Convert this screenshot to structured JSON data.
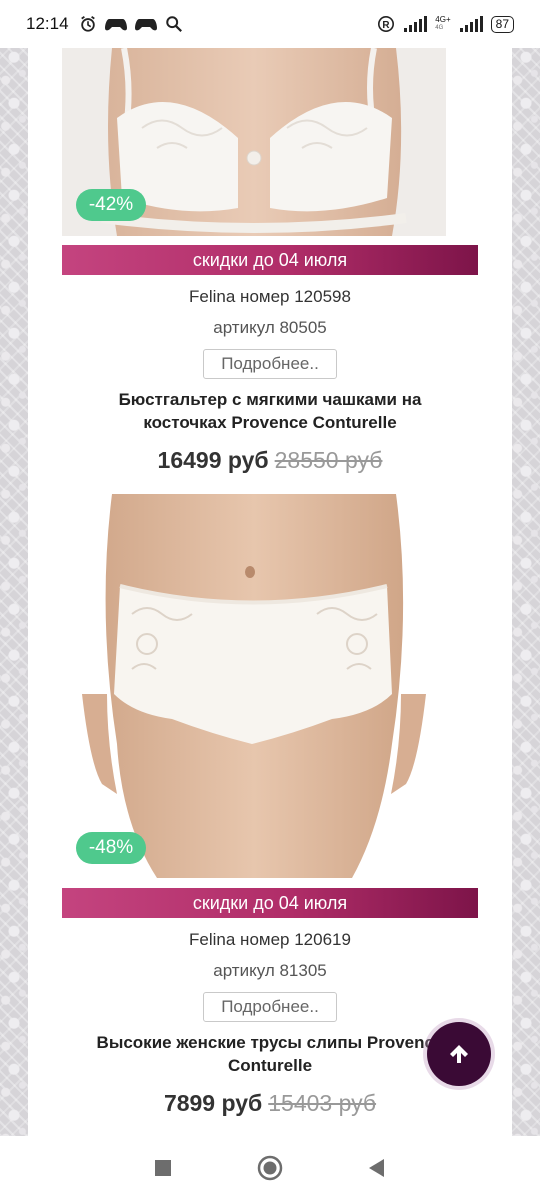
{
  "status_bar": {
    "time": "12:14",
    "network_top": "4G+",
    "network_bottom": "4G",
    "battery": "87",
    "icons": [
      "alarm-icon",
      "gamepad-icon",
      "gamepad-icon",
      "search-icon",
      "registered-icon",
      "signal-icon",
      "signal-icon"
    ]
  },
  "products": [
    {
      "discount": "-42%",
      "promo": "скидки до 04 июля",
      "brand": "Felina номер 120598",
      "sku": "артикул 80505",
      "details_label": "Подробнее..",
      "title": "Бюстгальтер с мягкими чашками на\nкосточках Provence Conturelle",
      "price_new": "16499 руб",
      "price_old": "28550 руб",
      "image": "bra-photo"
    },
    {
      "discount": "-48%",
      "promo": "скидки до 04 июля",
      "brand": "Felina номер 120619",
      "sku": "артикул 81305",
      "details_label": "Подробнее..",
      "title": "Высокие женские трусы слипы Provence\nConturelle",
      "price_new": "7899 руб",
      "price_old": "15403 руб",
      "image": "briefs-photo"
    }
  ],
  "colors": {
    "accent_dark": "#3a0a35",
    "badge_green": "#4fc98d",
    "promo_pink": "#b02d68"
  },
  "nav": [
    "recents-square-icon",
    "home-circle-icon",
    "back-triangle-icon"
  ]
}
